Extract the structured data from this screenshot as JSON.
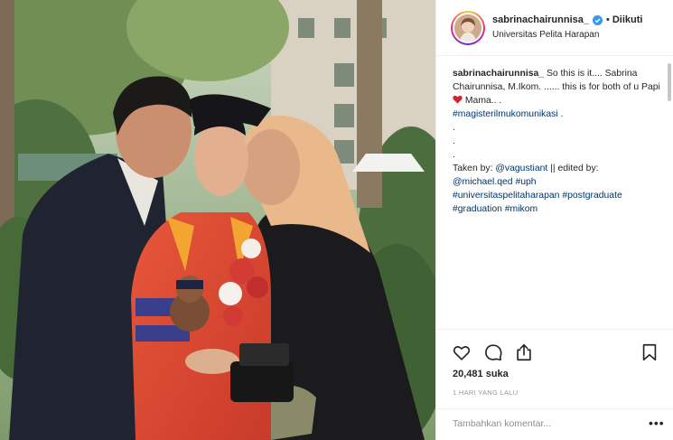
{
  "header": {
    "username": "sabrinachairunnisa_",
    "follow_status": "Diikuti",
    "separator": "•",
    "location": "Universitas Pelita Harapan"
  },
  "caption": {
    "username": "sabrinachairunnisa_",
    "line1": " So this is it.... Sabrina Chairunnisa, M.Ikom. ...... this is for both of u Papi ",
    "line1_after_heart": " Mama.. .",
    "hashtag_magister": "#magisterilmukomunikasi",
    "after_hashtag": " .",
    "dots": [
      ".",
      ".",
      "."
    ],
    "taken_by_label": "Taken by: ",
    "taken_by_user": "@vagustiant",
    "edited_by_label": " || edited by: ",
    "edited_by_user": "@michael.qed",
    "tag_uph": "#uph",
    "tag_university": "#universitaspelitaharapan",
    "tag_postgraduate": "#postgraduate",
    "tag_graduation": "#graduation",
    "tag_mikom": "#mikom"
  },
  "actions": {
    "likes": "20,481 suka",
    "time": "1 HARI YANG LALU"
  },
  "comment": {
    "placeholder": "Tambahkan komentar...",
    "more": "•••"
  },
  "colors": {
    "link": "#003569",
    "heart": "#ed4956",
    "verified": "#3897f0"
  }
}
